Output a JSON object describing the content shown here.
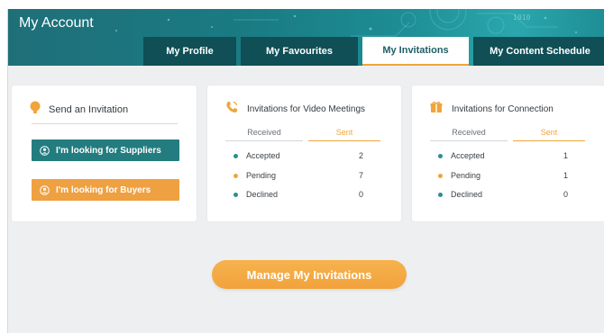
{
  "header": {
    "title": "My Account"
  },
  "tabs": [
    {
      "label": "My Profile"
    },
    {
      "label": "My Favourites"
    },
    {
      "label": "My Invitations"
    },
    {
      "label": "My Content Schedule"
    }
  ],
  "send_card": {
    "title": "Send an Invitation",
    "suppliers_label": "I'm looking for Suppliers",
    "buyers_label": "I'm looking for Buyers"
  },
  "video_card": {
    "title": "Invitations for Video Meetings",
    "tab_received": "Received",
    "tab_sent": "Sent",
    "rows": [
      {
        "label": "Accepted",
        "value": "2"
      },
      {
        "label": "Pending",
        "value": "7"
      },
      {
        "label": "Declined",
        "value": "0"
      }
    ]
  },
  "connection_card": {
    "title": "Invitations for Connection",
    "tab_received": "Received",
    "tab_sent": "Sent",
    "rows": [
      {
        "label": "Accepted",
        "value": "1"
      },
      {
        "label": "Pending",
        "value": "1"
      },
      {
        "label": "Declined",
        "value": "0"
      }
    ]
  },
  "manage_button": {
    "label": "Manage My Invitations"
  },
  "colors": {
    "teal": "#237c7f",
    "orange": "#f0a53a",
    "accepted": "#2a8f93",
    "pending": "#f0a53a",
    "declined": "#2a8f93"
  },
  "icons": {
    "send": "lightbulb-icon",
    "video": "phone-icon",
    "connection": "gift-icon",
    "user": "user-circle-icon"
  }
}
